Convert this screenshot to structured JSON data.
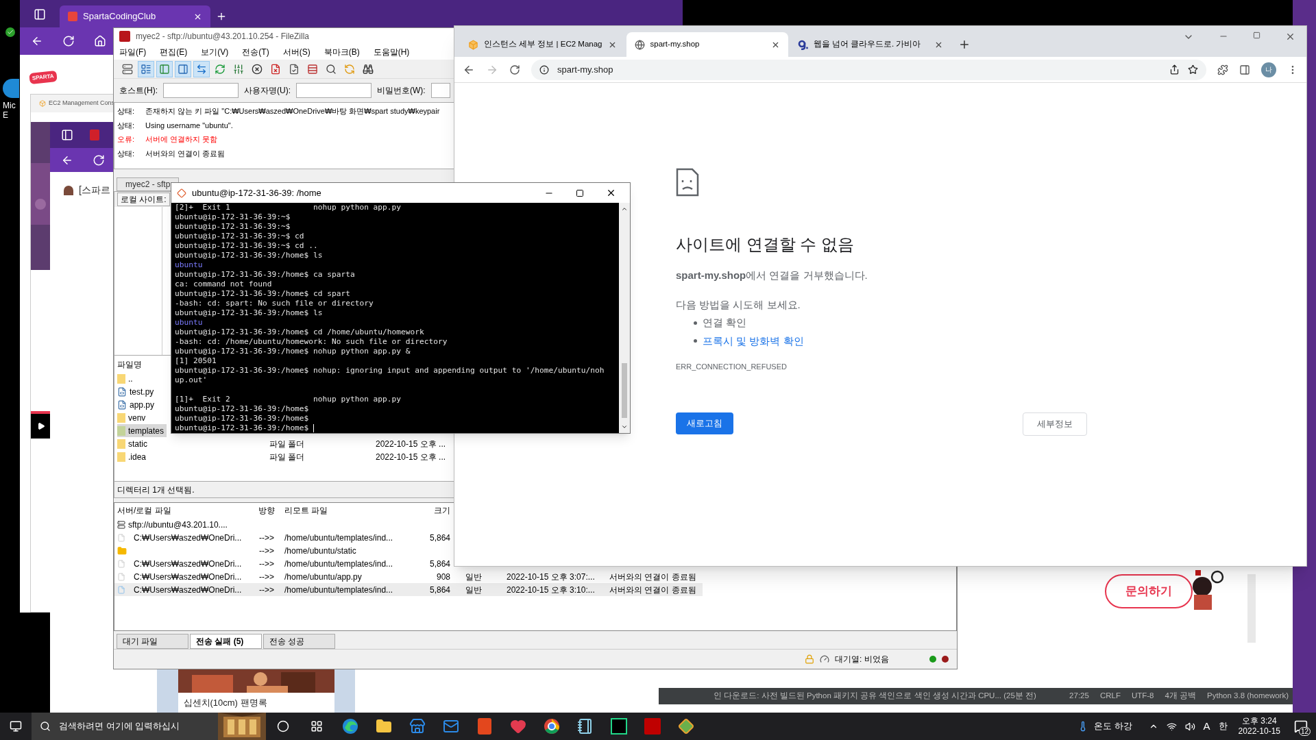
{
  "back_browser": {
    "tab": "SpartaCodingClub",
    "logo": "SPARTA",
    "inner_tab": "EC2 Management Cons",
    "page_text": "[스파르"
  },
  "desktop_icon": {
    "label_lines": [
      "Mic",
      "E"
    ]
  },
  "media_card": {
    "caption": "십센치(10cm) 팬명록"
  },
  "filezilla": {
    "title": "myec2 - sftp://ubuntu@43.201.10.254 - FileZilla",
    "menu": [
      "파일(F)",
      "편집(E)",
      "보기(V)",
      "전송(T)",
      "서버(S)",
      "북마크(B)",
      "도움말(H)"
    ],
    "toolbar": [
      {
        "kind": "server",
        "pressed": false
      },
      {
        "kind": "log",
        "pressed": true
      },
      {
        "kind": "left",
        "pressed": true
      },
      {
        "kind": "right",
        "pressed": true
      },
      {
        "kind": "swap",
        "pressed": true
      },
      {
        "kind": "refresh",
        "pressed": false
      },
      {
        "kind": "filter",
        "pressed": false
      },
      {
        "kind": "cancel",
        "pressed": false
      },
      {
        "kind": "disconnect",
        "pressed": false
      },
      {
        "kind": "reconnect",
        "pressed": false
      },
      {
        "kind": "compare",
        "pressed": false
      },
      {
        "kind": "search",
        "pressed": false
      },
      {
        "kind": "sync",
        "pressed": false
      },
      {
        "kind": "find",
        "pressed": false
      }
    ],
    "quickconnect": [
      "호스트(H):",
      "사용자명(U):",
      "비밀번호(W):"
    ],
    "log": [
      {
        "kind": "status",
        "label": "상태:",
        "text": "존재하지 않는 키 파일 \"C:₩Users₩aszed₩OneDrive₩바탕 화면₩spart study₩keypair"
      },
      {
        "kind": "status",
        "label": "상태:",
        "text": "Using username \"ubuntu\"."
      },
      {
        "kind": "error",
        "label": "오류:",
        "text": "서버에 연결하지 못함"
      },
      {
        "kind": "status",
        "label": "상태:",
        "text": "서버와의 연결이 종료됨"
      }
    ],
    "site_tabs": [
      "myec2 - sftp"
    ],
    "local_site_label": "로컬 사이트:",
    "files": {
      "header": "파일명",
      "rows": [
        {
          "name": "..",
          "kind": "folder",
          "selected": false
        },
        {
          "name": "test.py",
          "kind": "python",
          "selected": false
        },
        {
          "name": "app.py",
          "kind": "python",
          "selected": false
        },
        {
          "name": "venv",
          "kind": "folder",
          "selected": false
        },
        {
          "name": "templates",
          "kind": "folder",
          "selected": true
        },
        {
          "name": "static",
          "kind": "folder",
          "selected": false,
          "type": "파일 폴더",
          "date": "2022-10-15 오후 ..."
        },
        {
          "name": ".idea",
          "kind": "folder",
          "selected": false,
          "type": "파일 폴더",
          "date": "2022-10-15 오후 ..."
        }
      ]
    },
    "selection_status": "디렉터리 1개 선택됨.",
    "queue": {
      "columns": [
        "서버/로컬 파일",
        "방향",
        "리모트 파일",
        "크기"
      ],
      "rows": [
        {
          "kind": "server",
          "local": "sftp://ubuntu@43.201.10....",
          "selected": false
        },
        {
          "kind": "file",
          "local": "C:₩Users₩aszed₩OneDri...",
          "direction": "-->>",
          "remote": "/home/ubuntu/templates/ind...",
          "size": "5,864",
          "selected": false
        },
        {
          "kind": "folder",
          "direction": "-->>",
          "remote": "/home/ubuntu/static",
          "selected": false
        },
        {
          "kind": "file",
          "local": "C:₩Users₩aszed₩OneDri...",
          "direction": "-->>",
          "remote": "/home/ubuntu/templates/ind...",
          "size": "5,864",
          "selected": false
        },
        {
          "kind": "file",
          "local": "C:₩Users₩aszed₩OneDri...",
          "direction": "-->>",
          "remote": "/home/ubuntu/app.py",
          "size": "908",
          "priority": "일반",
          "time": "2022-10-15 오후 3:07:...",
          "reason": "서버와의 연결이 종료됨",
          "selected": false
        },
        {
          "kind": "file",
          "local": "C:₩Users₩aszed₩OneDri...",
          "direction": "-->>",
          "remote": "/home/ubuntu/templates/ind...",
          "size": "5,864",
          "priority": "일반",
          "time": "2022-10-15 오후 3:10:...",
          "reason": "서버와의 연결이 종료됨",
          "selected": true
        }
      ]
    },
    "queue_tabs": [
      {
        "label": "대기 파일",
        "selected": false
      },
      {
        "label": "전송 실패 (5)",
        "selected": true
      },
      {
        "label": "전송 성공",
        "selected": false
      }
    ],
    "status_bar": {
      "queue": "대기열: 비었음",
      "lights": [
        {
          "color": "#1a9a1a"
        },
        {
          "color": "#9a1a1a"
        }
      ]
    }
  },
  "terminal": {
    "title": "ubuntu@ip-172-31-36-39: /home",
    "lines": [
      {
        "kind": "text",
        "text": "[2]+  Exit 1                  nohup python app.py"
      },
      {
        "kind": "text",
        "text": "ubuntu@ip-172-31-36-39:~$"
      },
      {
        "kind": "text",
        "text": "ubuntu@ip-172-31-36-39:~$"
      },
      {
        "kind": "text",
        "text": "ubuntu@ip-172-31-36-39:~$ cd"
      },
      {
        "kind": "text",
        "text": "ubuntu@ip-172-31-36-39:~$ cd .."
      },
      {
        "kind": "text",
        "text": "ubuntu@ip-172-31-36-39:/home$ ls"
      },
      {
        "kind": "dir",
        "text": "ubuntu"
      },
      {
        "kind": "text",
        "text": "ubuntu@ip-172-31-36-39:/home$ ca sparta"
      },
      {
        "kind": "text",
        "text": "ca: command not found"
      },
      {
        "kind": "text",
        "text": "ubuntu@ip-172-31-36-39:/home$ cd spart"
      },
      {
        "kind": "text",
        "text": "-bash: cd: spart: No such file or directory"
      },
      {
        "kind": "text",
        "text": "ubuntu@ip-172-31-36-39:/home$ ls"
      },
      {
        "kind": "dir",
        "text": "ubuntu"
      },
      {
        "kind": "text",
        "text": "ubuntu@ip-172-31-36-39:/home$ cd /home/ubuntu/homework"
      },
      {
        "kind": "text",
        "text": "-bash: cd: /home/ubuntu/homework: No such file or directory"
      },
      {
        "kind": "text",
        "text": "ubuntu@ip-172-31-36-39:/home$ nohup python app.py &"
      },
      {
        "kind": "text",
        "text": "[1] 20501"
      },
      {
        "kind": "text",
        "text": "ubuntu@ip-172-31-36-39:/home$ nohup: ignoring input and appending output to '/home/ubuntu/noh"
      },
      {
        "kind": "text",
        "text": "up.out'"
      },
      {
        "kind": "blank"
      },
      {
        "kind": "text",
        "text": "[1]+  Exit 2                  nohup python app.py"
      },
      {
        "kind": "text",
        "text": "ubuntu@ip-172-31-36-39:/home$"
      },
      {
        "kind": "text",
        "text": "ubuntu@ip-172-31-36-39:/home$"
      },
      {
        "kind": "prompt",
        "text": "ubuntu@ip-172-31-36-39:/home$ "
      }
    ]
  },
  "chrome": {
    "tabs": [
      {
        "kind": "cube",
        "title": "인스턴스 세부 정보 | EC2 Manag",
        "selected": false
      },
      {
        "kind": "globe",
        "title": "spart-my.shop",
        "selected": true
      },
      {
        "kind": "letter",
        "title": "웹을 넘어 클라우드로. 가비아",
        "selected": false
      }
    ],
    "address": "spart-my.shop",
    "profile": "나",
    "error": {
      "heading": "사이트에 연결할 수 없음",
      "message": "**spart-my.shop**에서 연결을 거부했습니다.",
      "try": "다음 방법을 시도해 보세요.",
      "suggestions": [
        {
          "kind": "text",
          "text": "연결 확인"
        },
        {
          "kind": "link",
          "text": "프록시 및 방화벽 확인"
        }
      ],
      "code": "ERR_CONNECTION_REFUSED",
      "reload": "새로고침",
      "details": "세부정보"
    }
  },
  "pycharm": {
    "contact": "문의하기",
    "status": [
      "인 다운로드: 사전 빌드된 Python 패키지 공유 색인으로 색인 생성 시간과 CPU... (25분 전)",
      "27:25",
      "CRLF",
      "UTF-8",
      "4개 공백",
      "Python 3.8 (homework)"
    ]
  },
  "taskbar": {
    "search": "검색하려면 여기에 입력하십시",
    "apps": [
      {
        "kind": "cortana"
      },
      {
        "kind": "taskview"
      },
      {
        "kind": "edge"
      },
      {
        "kind": "explorer"
      },
      {
        "kind": "store"
      },
      {
        "kind": "mail"
      },
      {
        "kind": "office"
      },
      {
        "kind": "heart"
      },
      {
        "kind": "chrome"
      },
      {
        "kind": "notes"
      },
      {
        "kind": "pycharm"
      },
      {
        "kind": "filezilla"
      },
      {
        "kind": "git"
      }
    ],
    "weather": "온도 하강",
    "ime_mode": "A",
    "ime_lang": "한",
    "time": "오후 3:24",
    "date": "2022-10-15",
    "notifications": "12"
  }
}
